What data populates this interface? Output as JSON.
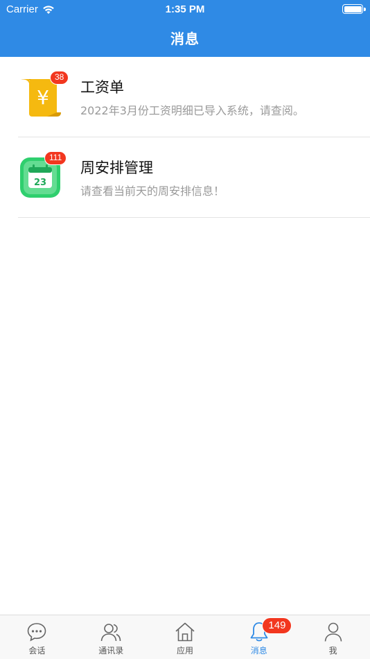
{
  "status_bar": {
    "carrier": "Carrier",
    "time": "1:35 PM"
  },
  "nav": {
    "title": "消息"
  },
  "messages": [
    {
      "title": "工资单",
      "preview": "2022年3月份工资明细已导入系统，请查阅。",
      "badge": "38",
      "icon": "payslip-icon"
    },
    {
      "title": "周安排管理",
      "preview": "请查看当前天的周安排信息！",
      "badge": "111",
      "icon": "calendar-icon"
    }
  ],
  "tabs": [
    {
      "label": "会话",
      "icon": "chat-bubble-icon"
    },
    {
      "label": "通讯录",
      "icon": "contacts-icon"
    },
    {
      "label": "应用",
      "icon": "home-icon"
    },
    {
      "label": "消息",
      "icon": "bell-icon",
      "active": true,
      "badge": "149"
    },
    {
      "label": "我",
      "icon": "person-icon"
    }
  ],
  "colors": {
    "accent": "#2f8ae5",
    "badge": "#f2371f",
    "payslip": "#f5b910",
    "calendar": "#2fcf6e"
  }
}
